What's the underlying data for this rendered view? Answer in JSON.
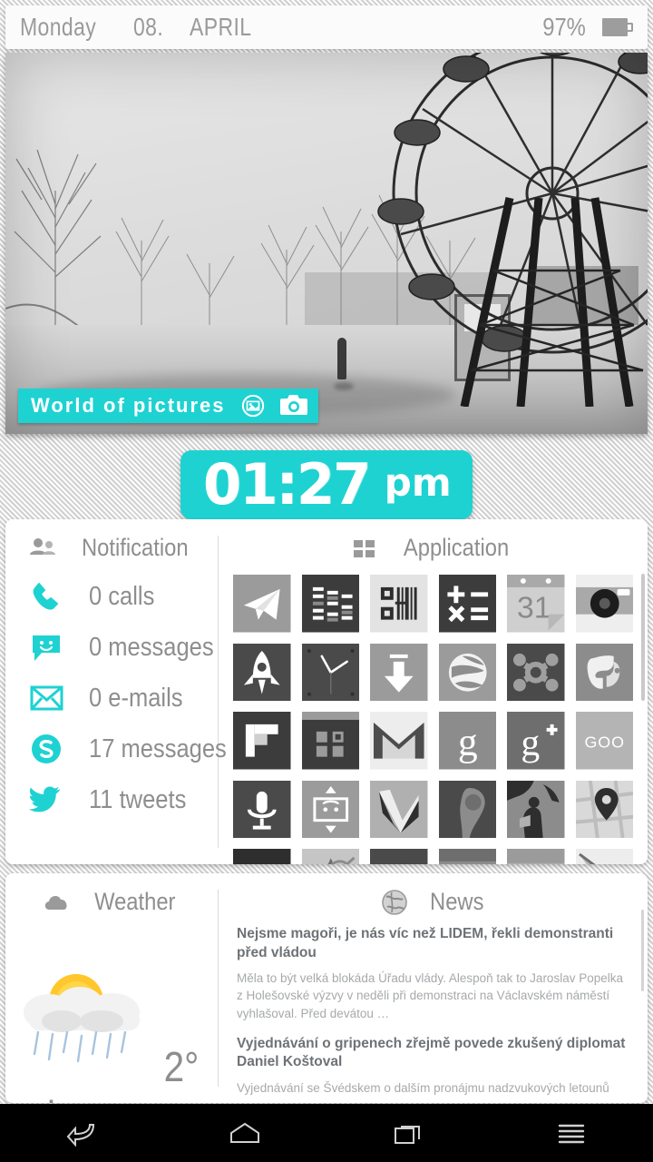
{
  "statusbar": {
    "day": "Monday",
    "date": "08.",
    "month": "APRIL",
    "battery_percent": "97%",
    "battery_icon": "battery-icon"
  },
  "photo_widget": {
    "label": "World of pictures",
    "gallery_icon": "gallery-icon",
    "camera_icon": "camera-icon",
    "scene_description": "black-and-white abandoned ferris wheel in winter"
  },
  "clock": {
    "time": "01:27",
    "ampm": "pm",
    "accent_color": "#1ED2D2"
  },
  "notification": {
    "header_icon": "contacts-icon",
    "header_title": "Notification",
    "items": [
      {
        "icon": "phone-icon",
        "label": "0 calls"
      },
      {
        "icon": "sms-icon",
        "label": "0 messages"
      },
      {
        "icon": "email-icon",
        "label": "0 e-mails"
      },
      {
        "icon": "skype-icon",
        "label": "17 messages"
      },
      {
        "icon": "twitter-icon",
        "label": "11 tweets"
      }
    ]
  },
  "application": {
    "header_icon": "grid-icon",
    "header_title": "Application",
    "icons": [
      "paper-plane-icon",
      "equalizer-icon",
      "qr-scanner-icon",
      "calculator-icon",
      "calendar-31-icon",
      "camera-app-icon",
      "rocket-icon",
      "clock-app-icon",
      "download-icon",
      "google-earth-icon",
      "avast-icon",
      "evernote-icon",
      "flipboard-icon",
      "widgets-icon",
      "gmail-icon",
      "google-icon",
      "google-plus-icon",
      "goo-gl-icon",
      "voice-search-icon",
      "screen-resize-icon",
      "checkmark-icon",
      "map-pin-icon",
      "play-books-icon",
      "google-maps-icon",
      "keyboard-icon",
      "drawing-icon",
      "chrome-icon",
      "circle-app-icon",
      "speech-app-icon",
      "pencil-icon"
    ],
    "calendar_day": "31",
    "google_letter": "g",
    "google_plus_letter": "g",
    "goo_text": "GOO"
  },
  "weather": {
    "header_icon": "cloud-icon",
    "header_title": "Weather",
    "art_icon": "sun-behind-rain-cloud-icon",
    "temperature": "2°",
    "condition": "rain"
  },
  "news": {
    "header_icon": "globe-icon",
    "header_title": "News",
    "articles": [
      {
        "title": "Nejsme magoři, je nás víc než LIDEM, řekli demonstranti před vládou",
        "body": "Měla to být velká blokáda Úřadu vlády. Alespoň tak to Jaroslav Popelka z Holešovské výzvy v neděli při demonstraci na Václavském náměstí vyhlašoval. Před devátou …"
      },
      {
        "title": "Vyjednávání o gripenech zřejmě povede zkušený diplomat Daniel Koštoval",
        "body": "Vyjednávání se Švédskem o dalším pronájmu nadzvukových letounů"
      }
    ]
  },
  "navbar": {
    "buttons": [
      {
        "icon": "back-icon",
        "label": "Back"
      },
      {
        "icon": "home-icon",
        "label": "Home"
      },
      {
        "icon": "recents-icon",
        "label": "Recent apps"
      },
      {
        "icon": "menu-icon",
        "label": "Menu"
      }
    ]
  }
}
